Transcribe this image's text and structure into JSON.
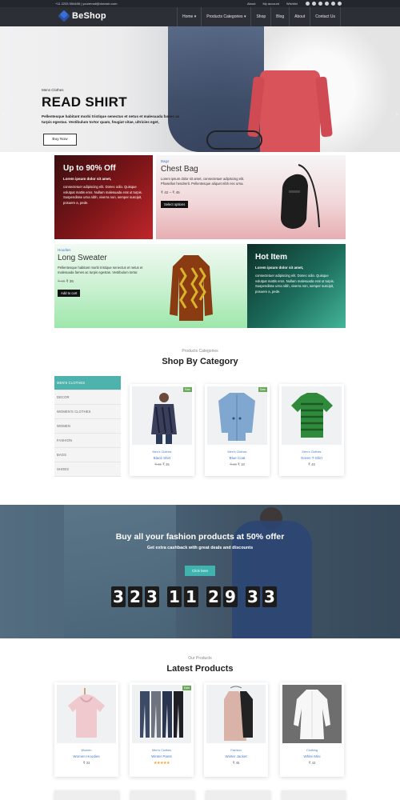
{
  "topbar": {
    "contact": "+11 2233 554488 | youremail@domain.com",
    "links": [
      "About",
      "My account",
      "Wishlist"
    ],
    "social_icons": [
      "facebook-icon",
      "twitter-icon",
      "google-icon",
      "linkedin-icon",
      "instagram-icon",
      "pinterest-icon"
    ]
  },
  "header": {
    "logo": "BeShop",
    "nav": [
      "Home ▾",
      "Products Categories ▾",
      "Shop",
      "Blog",
      "About",
      "Contact Us"
    ]
  },
  "hero": {
    "subtitle": "Mens Clothes",
    "title": "READ SHIRT",
    "description": "Pellentesque habitant morbi tristique senectus et netus et malesuada fames ac turpis egestas. Vestibulum tortor quam, feugiat vitae, ultricies eget,",
    "button": "Buy Now",
    "prev_arrow": "‹",
    "next_arrow": "›"
  },
  "promos": {
    "p1": {
      "title": "Up to 90% Off",
      "bold": "Lorem ipsum dolor sit amet,",
      "text": "consectetuer adipiscing elit. Donec odio. Quisque volutpat mattis eros. Nullam malesuada erat ut turpis. Suspendisse urna nibh, viverra non, semper suscipit, posuere a, pede."
    },
    "p2": {
      "label": "Bags",
      "title": "Chest Bag",
      "text": "Lorem ipsum dolor sit amet, consectetuer adipiscing elit. Phasellus hendrerit. Pellentesque aliquet nibh nec urna.",
      "price": "₹ 42 – ₹ 45",
      "button": "Select options"
    },
    "p3": {
      "label": "Hoodies",
      "title": "Long Sweater",
      "text": "Pellentesque habitant morbi tristique senectus et netus et malesuada fames ac turpis egestas. Vestibulum tortor.",
      "price_old": "₹ 45",
      "price_new": "₹ 35",
      "button": "Add to cart"
    },
    "p4": {
      "title": "Hot Item",
      "bold": "Lorem ipsum dolor sit amet,",
      "text": "consectetuer adipiscing elit. Donec odio. Quisque volutpat mattis eros. Nullam malesuada erat ut turpis. Suspendisse urna nibh, viverra non, semper suscipit, posuere a, pede."
    }
  },
  "categories_section": {
    "subtitle": "Products Categories",
    "title": "Shop By Category",
    "categories": [
      "MEN'S CLOTHES",
      "DECOR",
      "WOMEN'S CLOTHES",
      "WOMEN",
      "FASHION",
      "BAGS",
      "SHOES"
    ],
    "products": [
      {
        "category": "Men's Clothes",
        "name": "Black Shirt",
        "price_old": "₹ 45",
        "price": "₹ 35",
        "sale": "Sale"
      },
      {
        "category": "Men's Clothes",
        "name": "Blue Coat",
        "price_old": "₹ 20",
        "price": "₹ 18",
        "sale": "Sale"
      },
      {
        "category": "Men's Clothes",
        "name": "Green T-Shirt",
        "price_old": "",
        "price": "₹ 45",
        "sale": ""
      }
    ]
  },
  "banner": {
    "title": "Buy all your fashion products at 50% offer",
    "subtitle": "Get extra cashback with great deals and discounts",
    "button": "Click here",
    "countdown": [
      "3",
      "2",
      "3",
      "1",
      "1",
      "2",
      "9",
      "3",
      "3"
    ]
  },
  "latest_section": {
    "subtitle": "Our Products",
    "title": "Latest Products",
    "products": [
      {
        "category": "Women",
        "name": "Women Hoodies",
        "price": "₹ 33",
        "sale": "",
        "stars": ""
      },
      {
        "category": "Men's Clothes",
        "name": "Winter Pants",
        "price": "",
        "sale": "Sale",
        "stars": "★★★★★"
      },
      {
        "category": "Fashion",
        "name": "Winter Jacket",
        "price": "₹ 45",
        "sale": "",
        "stars": ""
      },
      {
        "category": "Clothing",
        "name": "White Mini",
        "price": "₹ 43",
        "sale": "",
        "stars": ""
      }
    ]
  },
  "colors": {
    "accent": "#3fb3ad",
    "dark": "#2c2f36",
    "link": "#4a7ac8"
  }
}
